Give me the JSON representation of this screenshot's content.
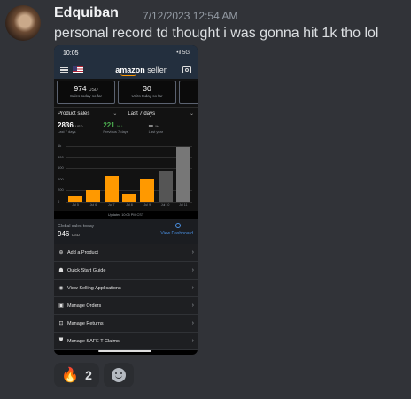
{
  "message": {
    "username": "Edquiban",
    "timestamp": "7/12/2023 12:54 AM",
    "text": "personal record td thought i was gonna hit 1k tho lol"
  },
  "phone": {
    "status_time": "10:05",
    "status_right": "•ıl 5G",
    "app_logo_amazon": "amazon",
    "app_logo_seller": " seller",
    "cards": [
      {
        "value": "974",
        "unit": "USD",
        "label": "Sales today so far"
      },
      {
        "value": "30",
        "unit": "",
        "label": "Units today so far"
      },
      {
        "value": "1(",
        "unit": "",
        "label": "Cu"
      }
    ],
    "dropdown_left": "Product sales",
    "dropdown_right": "Last 7 days",
    "stats": [
      {
        "value": "2836",
        "unit": "USD",
        "label": "Last 7 days"
      },
      {
        "value": "221",
        "unit": "% ↑",
        "label": "Previous 7 days"
      },
      {
        "value": "-- ",
        "unit": "%",
        "label": "Last year"
      }
    ],
    "updated": "Updated 10:05 PM CST",
    "global_title": "Global sales today",
    "global_value": "946",
    "global_unit": "USD",
    "global_link": "View Dashboard",
    "menu": [
      {
        "icon": "add-icon",
        "glyph": "⊕",
        "label": "Add a Product"
      },
      {
        "icon": "grad-cap-icon",
        "glyph": "☗",
        "label": "Quick Start Guide"
      },
      {
        "icon": "eye-icon",
        "glyph": "◉",
        "label": "View Selling Applications"
      },
      {
        "icon": "box-icon",
        "glyph": "▣",
        "label": "Manage Orders"
      },
      {
        "icon": "return-icon",
        "glyph": "⊡",
        "label": "Manage Returns"
      },
      {
        "icon": "shield-icon",
        "glyph": "⛊",
        "label": "Manage SAFE T Claims"
      }
    ]
  },
  "reactions": [
    {
      "emoji": "🔥",
      "count": "2"
    }
  ],
  "chart_data": {
    "type": "bar",
    "categories": [
      "Jul 5",
      "Jul 6",
      "Jul 7",
      "Jul 8",
      "Jul 9",
      "Jul 10",
      "Jul 11"
    ],
    "values": [
      110,
      200,
      460,
      140,
      420,
      550,
      990
    ],
    "ytick_labels": [
      "1k",
      "800",
      "600",
      "400",
      "200",
      "0"
    ],
    "ylim": [
      0,
      1000
    ],
    "colors": [
      "#ff9900",
      "#ff9900",
      "#ff9900",
      "#ff9900",
      "#ff9900",
      "#555555",
      "#777777"
    ]
  }
}
